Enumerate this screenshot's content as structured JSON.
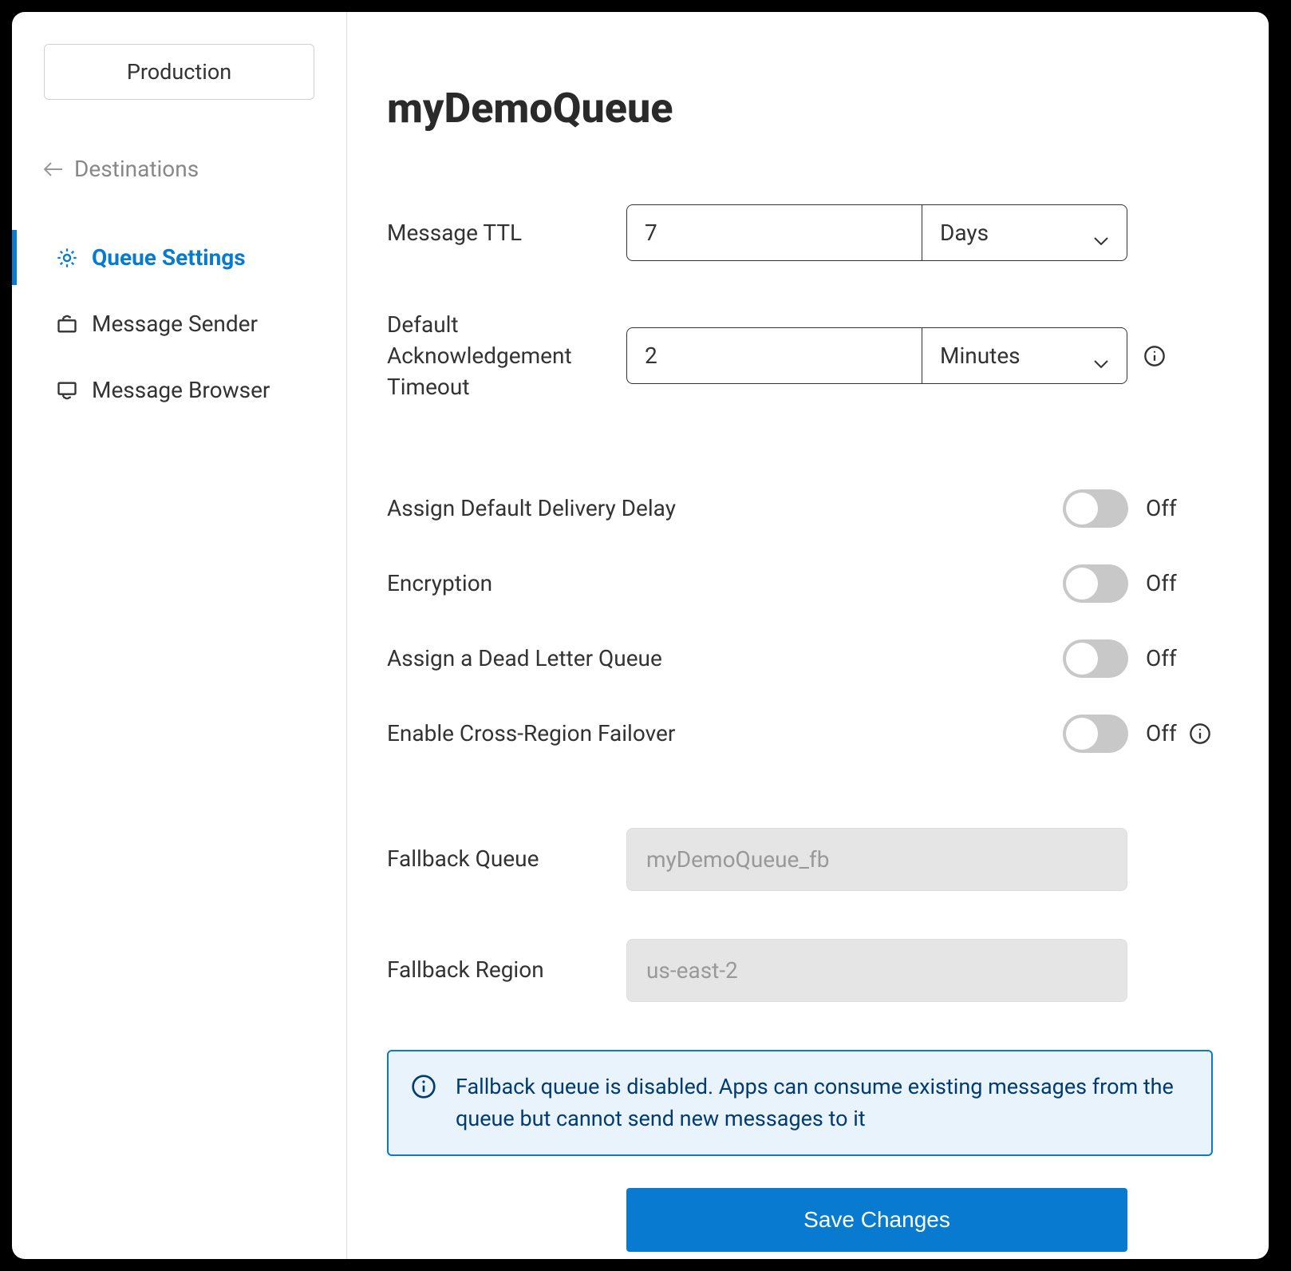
{
  "sidebar": {
    "environment": "Production",
    "breadcrumb": "Destinations",
    "items": [
      {
        "label": "Queue Settings"
      },
      {
        "label": "Message Sender"
      },
      {
        "label": "Message Browser"
      }
    ]
  },
  "main": {
    "title": "myDemoQueue",
    "messageTTL": {
      "label": "Message TTL",
      "value": "7",
      "unit": "Days"
    },
    "ackTimeout": {
      "label": "Default Acknowledgement Timeout",
      "value": "2",
      "unit": "Minutes"
    },
    "toggles": {
      "deliveryDelay": {
        "label": "Assign Default Delivery Delay",
        "state": "Off"
      },
      "encryption": {
        "label": "Encryption",
        "state": "Off"
      },
      "deadLetter": {
        "label": "Assign a Dead Letter Queue",
        "state": "Off"
      },
      "crossRegion": {
        "label": "Enable Cross-Region Failover",
        "state": "Off"
      }
    },
    "fallbackQueue": {
      "label": "Fallback Queue",
      "value": "myDemoQueue_fb"
    },
    "fallbackRegion": {
      "label": "Fallback Region",
      "value": "us-east-2"
    },
    "infoBox": "Fallback queue is disabled. Apps can consume existing messages from the queue but cannot send new messages to it",
    "saveButton": "Save Changes"
  }
}
